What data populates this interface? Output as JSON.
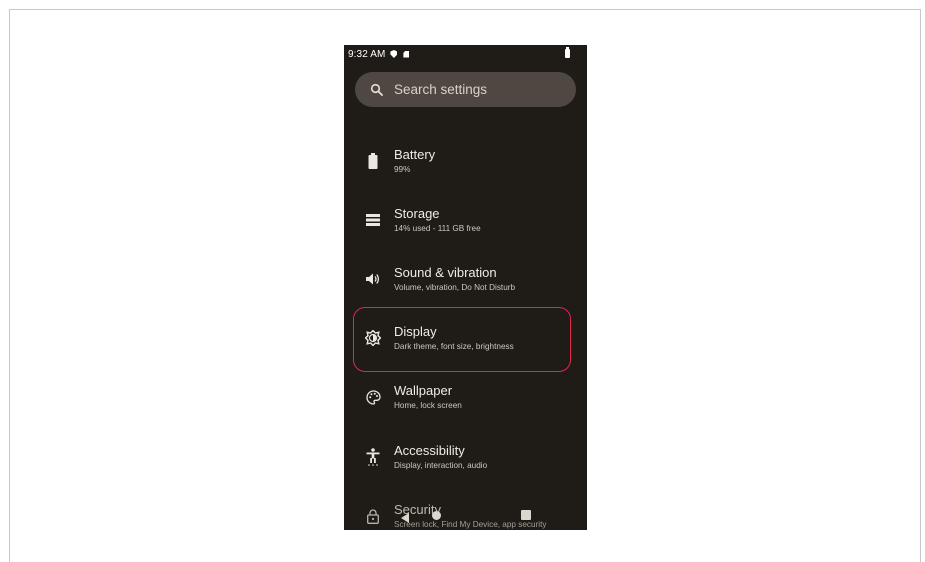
{
  "status_bar": {
    "time": "9:32 AM"
  },
  "search": {
    "placeholder": "Search settings"
  },
  "items": [
    {
      "title": "Battery",
      "subtitle": "99%",
      "icon": "battery-icon"
    },
    {
      "title": "Storage",
      "subtitle": "14% used - 111 GB free",
      "icon": "storage-icon"
    },
    {
      "title": "Sound & vibration",
      "subtitle": "Volume, vibration, Do Not Disturb",
      "icon": "speaker-icon"
    },
    {
      "title": "Display",
      "subtitle": "Dark theme, font size, brightness",
      "icon": "brightness-icon"
    },
    {
      "title": "Wallpaper",
      "subtitle": "Home, lock screen",
      "icon": "palette-icon"
    },
    {
      "title": "Accessibility",
      "subtitle": "Display, interaction, audio",
      "icon": "accessibility-icon"
    },
    {
      "title": "Security",
      "subtitle": "Screen lock, Find My Device, app security",
      "icon": "lock-icon"
    }
  ],
  "colors": {
    "background": "#1f1b16",
    "highlight": "#e0284f",
    "search_bg": "#4f4842"
  }
}
